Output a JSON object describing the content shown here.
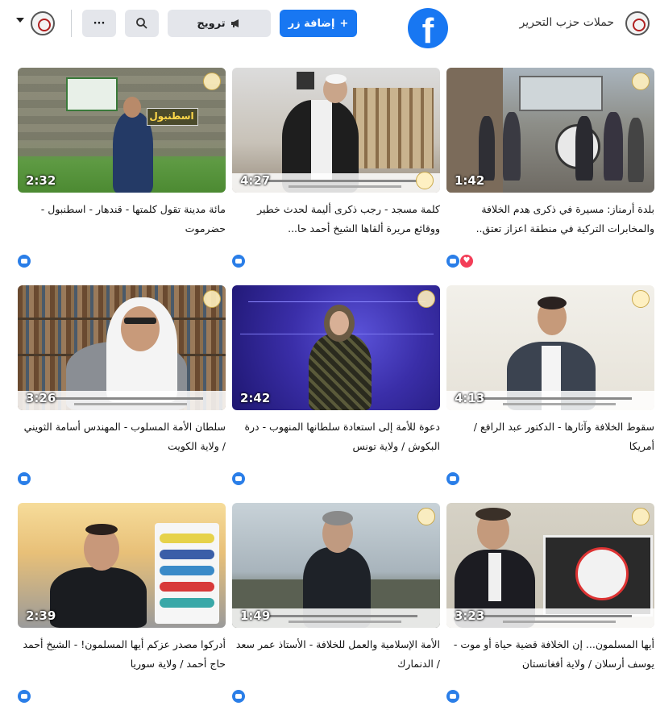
{
  "header": {
    "page_name": "حملات حزب التحرير",
    "add_button": "إضافة زر",
    "add_icon": "+",
    "promote_button": "ترويج",
    "promote_icon": "megaphone-icon",
    "search_icon": "search-icon",
    "more_icon": "···",
    "logo_letter": "f"
  },
  "videos": [
    {
      "title": "بلدة أرمناز: مسيرة في ذكرى هدم الخلافة والمخابرات التركية في منطقة اعزاز تعتق..",
      "duration": "1:42",
      "reactions": [
        "like",
        "love"
      ]
    },
    {
      "title": "كلمة مسجد - رجب ذكرى أليمة لحدث خطير ووقائع مريرة ألقاها الشيخ أحمد حا...",
      "duration": "4:27",
      "reactions": [
        "like"
      ]
    },
    {
      "title": "مائة مدينة تقول كلمتها - قندهار - اسطنبول - حضرموت",
      "duration": "2:32",
      "reactions": [
        "like"
      ],
      "overlay_text": "اسطنبول"
    },
    {
      "title": "سقوط الخلافة وآثارها - الدكتور عبد الرافع / أمريكا",
      "duration": "4:13",
      "reactions": [
        "like"
      ]
    },
    {
      "title": "دعوة للأمة إلى استعادة سلطانها المنهوب - درة البكوش / ولاية تونس",
      "duration": "2:42",
      "reactions": [
        "like"
      ]
    },
    {
      "title": "سلطان الأمة المسلوب - المهندس أسامة الثويني / ولاية الكويت",
      "duration": "3:26",
      "reactions": [
        "like"
      ]
    },
    {
      "title": "أيها المسلمون... إن الخلافة قضية حياة أو موت - يوسف أرسلان / ولاية أفغانستان",
      "duration": "3:23",
      "reactions": [
        "like"
      ]
    },
    {
      "title": "الأمة الإسلامية والعمل للخلافة - الأستاذ عمر سعد / الدنمارك",
      "duration": "1:49",
      "reactions": [
        "like"
      ]
    },
    {
      "title": "أدركوا مصدر عزكم أيها المسلمون! - الشيخ أحمد حاج أحمد / ولاية سوريا",
      "duration": "2:39",
      "reactions": [
        "like"
      ]
    }
  ],
  "colors": {
    "brand": "#1877f2",
    "like": "#2a7ee8",
    "love": "#f33e58"
  }
}
